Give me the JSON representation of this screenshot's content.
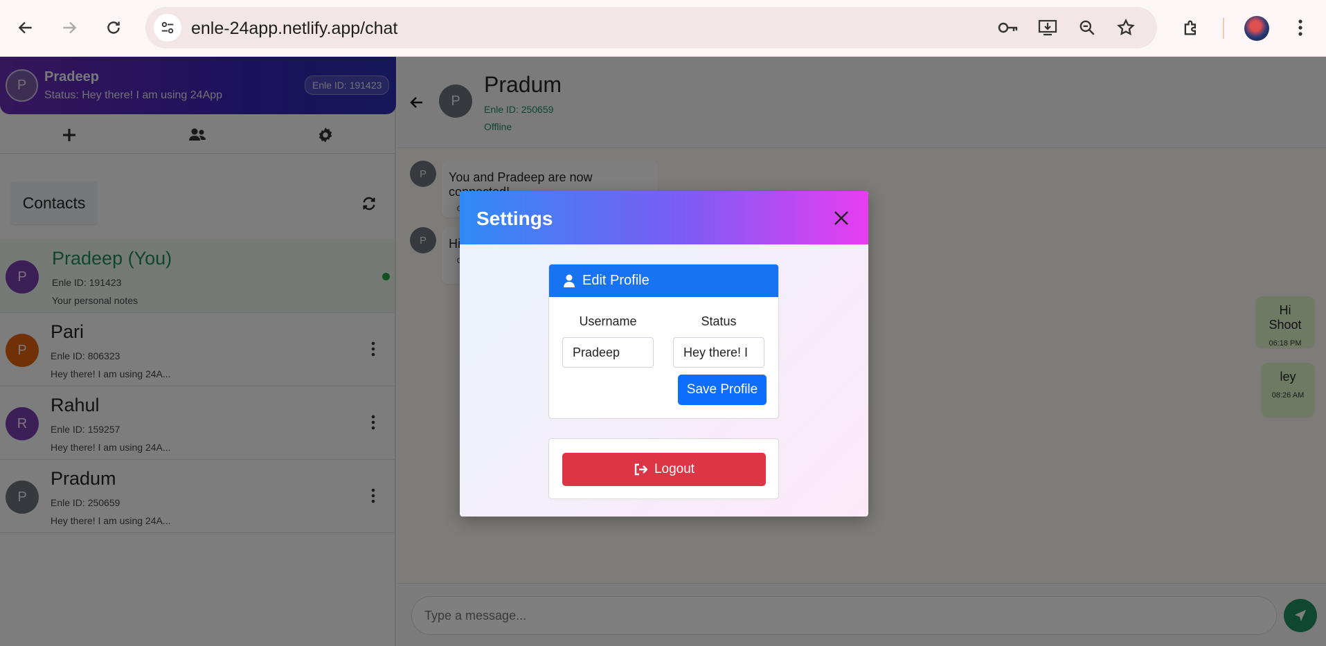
{
  "browser": {
    "url": "enle-24app.netlify.app/chat",
    "icons": [
      "back-arrow-icon",
      "forward-arrow-icon",
      "reload-icon",
      "site-settings-icon",
      "password-key-icon",
      "install-app-icon",
      "zoom-icon",
      "bookmark-star-icon",
      "extensions-icon",
      "profile-avatar",
      "menu-kebab-icon"
    ]
  },
  "user_header": {
    "avatar_letter": "P",
    "name": "Pradeep",
    "status": "Status: Hey there! I am using 24App",
    "id_badge": "Enle ID: 191423"
  },
  "tabs": [
    "add-contact",
    "groups",
    "settings"
  ],
  "contacts": {
    "title": "Contacts",
    "items": [
      {
        "letter": "P",
        "name": "Pradeep (You)",
        "id": "Enle ID: 191423",
        "desc": "Your personal notes",
        "color": "#7b3fb0",
        "online": true
      },
      {
        "letter": "P",
        "name": "Pari",
        "id": "Enle ID: 806323",
        "desc": "Hey there! I am using 24A...",
        "color": "#e0630f"
      },
      {
        "letter": "R",
        "name": "Rahul",
        "id": "Enle ID: 159257",
        "desc": "Hey there! I am using 24A...",
        "color": "#7b3fb0"
      },
      {
        "letter": "P",
        "name": "Pradum",
        "id": "Enle ID: 250659",
        "desc": "Hey there! I am using 24A...",
        "color": "#6c757d"
      }
    ]
  },
  "chat": {
    "avatar_letter": "P",
    "name": "Pradum",
    "id": "Enle ID: 250659",
    "status": "Offline",
    "messages_in": [
      {
        "avatar": "P",
        "text": "You and Pradeep are now connected!",
        "time": "0"
      },
      {
        "avatar": "P",
        "text": "Hi",
        "time": "0"
      }
    ],
    "messages_out": [
      {
        "text": "Hi Shoot",
        "time": "06:18 PM"
      },
      {
        "text": "ley",
        "time": "08:26 AM"
      }
    ],
    "input_placeholder": "Type a message..."
  },
  "settings_modal": {
    "title": "Settings",
    "edit_profile": {
      "heading": "Edit Profile",
      "username_label": "Username",
      "status_label": "Status",
      "username_value": "Pradeep",
      "status_value": "Hey there! I",
      "save_label": "Save Profile"
    },
    "logout_label": "Logout"
  },
  "colors": {
    "accent_green": "#1e8f63",
    "primary_blue": "#0d6efd",
    "danger_red": "#dc3545"
  }
}
